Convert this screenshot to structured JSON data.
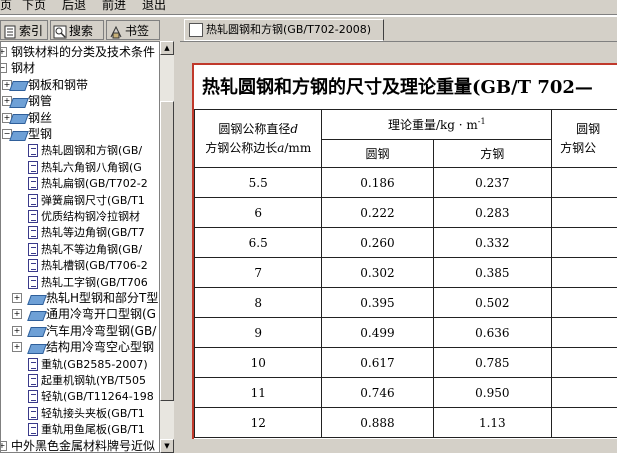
{
  "menu": {
    "items": [
      "页",
      "下页",
      "后退",
      "前进",
      "退出"
    ]
  },
  "left_tabs": [
    {
      "label": "索引",
      "icon": "index-icon"
    },
    {
      "label": "搜索",
      "icon": "search-icon"
    },
    {
      "label": "书签",
      "icon": "bookmark-icon"
    }
  ],
  "tree": {
    "items": [
      {
        "label": "钢铁材料的分类及技术条件",
        "level": 0,
        "kind": "folder",
        "expander": "plus"
      },
      {
        "label": "钢材",
        "level": 0,
        "kind": "folder",
        "expander": "minus"
      },
      {
        "label": "钢板和钢带",
        "level": 1,
        "kind": "book",
        "expander": "plus"
      },
      {
        "label": "钢管",
        "level": 1,
        "kind": "book",
        "expander": "plus"
      },
      {
        "label": "钢丝",
        "level": 1,
        "kind": "book",
        "expander": "plus"
      },
      {
        "label": "型钢",
        "level": 1,
        "kind": "book",
        "expander": "minus"
      },
      {
        "label": "热轧圆钢和方钢(GB/",
        "level": 2,
        "kind": "page",
        "selected": true
      },
      {
        "label": "热轧六角钢八角钢(G",
        "level": 2,
        "kind": "page"
      },
      {
        "label": "热轧扁钢(GB/T702-2",
        "level": 2,
        "kind": "page"
      },
      {
        "label": "弹簧扁钢尺寸(GB/T1",
        "level": 2,
        "kind": "page"
      },
      {
        "label": "优质结构钢冷拉钢材",
        "level": 2,
        "kind": "page"
      },
      {
        "label": "热轧等边角钢(GB/T7",
        "level": 2,
        "kind": "page"
      },
      {
        "label": "热轧不等边角钢(GB/",
        "level": 2,
        "kind": "page"
      },
      {
        "label": "热轧槽钢(GB/T706-2",
        "level": 2,
        "kind": "page"
      },
      {
        "label": "热轧工字钢(GB/T706",
        "level": 2,
        "kind": "page"
      },
      {
        "label": "热轧H型钢和部分T型",
        "level": 2,
        "kind": "book",
        "expander": "plus"
      },
      {
        "label": "通用冷弯开口型钢(G",
        "level": 2,
        "kind": "book",
        "expander": "plus"
      },
      {
        "label": "汽车用冷弯型钢(GB/",
        "level": 2,
        "kind": "book",
        "expander": "plus"
      },
      {
        "label": "结构用冷弯空心型钢",
        "level": 2,
        "kind": "book",
        "expander": "plus"
      },
      {
        "label": "重轨(GB2585-2007)",
        "level": 2,
        "kind": "page"
      },
      {
        "label": "起重机钢轨(YB/T505",
        "level": 2,
        "kind": "page"
      },
      {
        "label": "轻轨(GB/T11264-198",
        "level": 2,
        "kind": "page"
      },
      {
        "label": "轻轨接头夹板(GB/T1",
        "level": 2,
        "kind": "page"
      },
      {
        "label": "重轨用鱼尾板(GB/T1",
        "level": 2,
        "kind": "page"
      },
      {
        "label": "中外黑色金属材料牌号近似",
        "level": 0,
        "kind": "folder",
        "expander": "plus"
      }
    ]
  },
  "doc_tab": {
    "label": "热轧圆钢和方钢(GB/T702-2008)"
  },
  "document": {
    "title": "热轧圆钢和方钢的尺寸及理论重量(GB/T 702—",
    "header_col1_line1": "圆钢公称直径",
    "header_col1_var1": "d",
    "header_col1_line2": "方钢公称边长",
    "header_col1_var2": "a",
    "header_col1_unit": "/mm",
    "header_weight": "理论重量/kg · m",
    "header_weight_exp": "-1",
    "header_round": "圆钢",
    "header_square": "方钢",
    "header_col4_line1": "圆钢",
    "header_col4_line2": "方钢公",
    "rows": [
      {
        "size": "5.5",
        "round": "0.186",
        "square": "0.237"
      },
      {
        "size": "6",
        "round": "0.222",
        "square": "0.283"
      },
      {
        "size": "6.5",
        "round": "0.260",
        "square": "0.332"
      },
      {
        "size": "7",
        "round": "0.302",
        "square": "0.385"
      },
      {
        "size": "8",
        "round": "0.395",
        "square": "0.502"
      },
      {
        "size": "9",
        "round": "0.499",
        "square": "0.636"
      },
      {
        "size": "10",
        "round": "0.617",
        "square": "0.785"
      },
      {
        "size": "11",
        "round": "0.746",
        "square": "0.950"
      },
      {
        "size": "12",
        "round": "0.888",
        "square": "1.13"
      }
    ]
  },
  "colors": {
    "selected_highlight": "#d4d0c8",
    "page_border": "#c0392b",
    "book_icon": "#6ea0d6"
  }
}
